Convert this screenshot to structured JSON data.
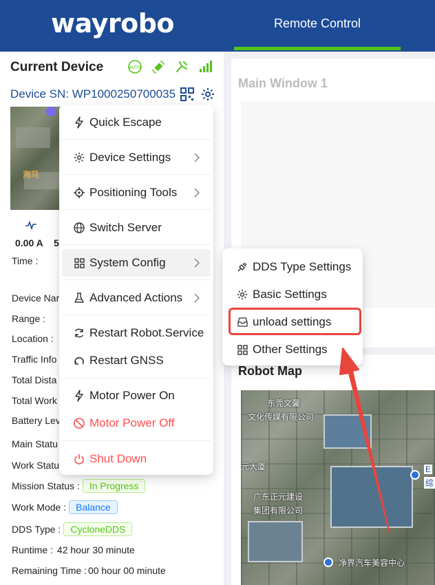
{
  "header": {
    "logo": "wayrobo",
    "tab_remote": "Remote Control"
  },
  "colors": {
    "brand": "#1d4b96",
    "accent_green": "#52c41a",
    "danger": "#ff4d4f",
    "highlight": "#e8453c"
  },
  "left_panel": {
    "title": "Current Device",
    "status_icons": [
      "auto-mode-icon",
      "satellite-icon",
      "robot-arm-icon",
      "signal-bars-icon"
    ],
    "device_sn": "Device SN: WP1000250700035",
    "thumb_poi": "海马",
    "current_a": "0.00 A",
    "current_b": "5",
    "rows": {
      "time_label": "Time :",
      "device_name_label": "Device Nar",
      "range_label": "Range :",
      "location_label": "Location :",
      "traffic_label": "Traffic Info",
      "total_distance_label": "Total Dista",
      "total_work_label": "Total Work",
      "battery_label": "Battery Lev",
      "main_status_label": "Main Statu",
      "work_status_label": "Work Statu",
      "mission_status_label": "Mission Status :",
      "mission_status_value": "In Progress",
      "work_mode_label": "Work Mode :",
      "work_mode_value": "Balance",
      "dds_type_label": "DDS Type :",
      "dds_type_value": "CycloneDDS",
      "runtime_label": "Runtime :",
      "runtime_value": "42 hour 30 minute",
      "remaining_label": "Remaining Time :",
      "remaining_value": "00 hour 00 minute"
    }
  },
  "main_window": {
    "title": "Main Window 1"
  },
  "robot_map": {
    "title": "Robot Map",
    "labels": [
      "东莞文馨",
      "文化传媒有限公司",
      "元大厦",
      "广东正元建设",
      "集团有限公司",
      "净界汽车美容中心"
    ],
    "edge_labels": [
      "E",
      "综"
    ]
  },
  "menu": {
    "items": [
      {
        "label": "Quick Escape",
        "icon": "lightning-icon"
      },
      {
        "label": "Device Settings",
        "icon": "gear-icon"
      },
      {
        "label": "Positioning Tools",
        "icon": "crosshair-icon"
      },
      {
        "label": "Switch Server",
        "icon": "globe-icon"
      },
      {
        "label": "System Config",
        "icon": "grid-icon"
      },
      {
        "label": "Advanced Actions",
        "icon": "flask-icon"
      },
      {
        "label": "Restart Robot.Service",
        "icon": "refresh-icon"
      },
      {
        "label": "Restart GNSS",
        "icon": "reload-icon"
      },
      {
        "label": "Motor Power On",
        "icon": "lightning-icon"
      },
      {
        "label": "Motor Power Off",
        "icon": "stop-icon"
      },
      {
        "label": "Shut Down",
        "icon": "power-icon"
      }
    ]
  },
  "submenu": {
    "items": [
      {
        "label": "DDS Type Settings",
        "icon": "plug-icon"
      },
      {
        "label": "Basic Settings",
        "icon": "gear-icon"
      },
      {
        "label": "unload settings",
        "icon": "inbox-icon"
      },
      {
        "label": "Other Settings",
        "icon": "grid-icon"
      }
    ]
  }
}
